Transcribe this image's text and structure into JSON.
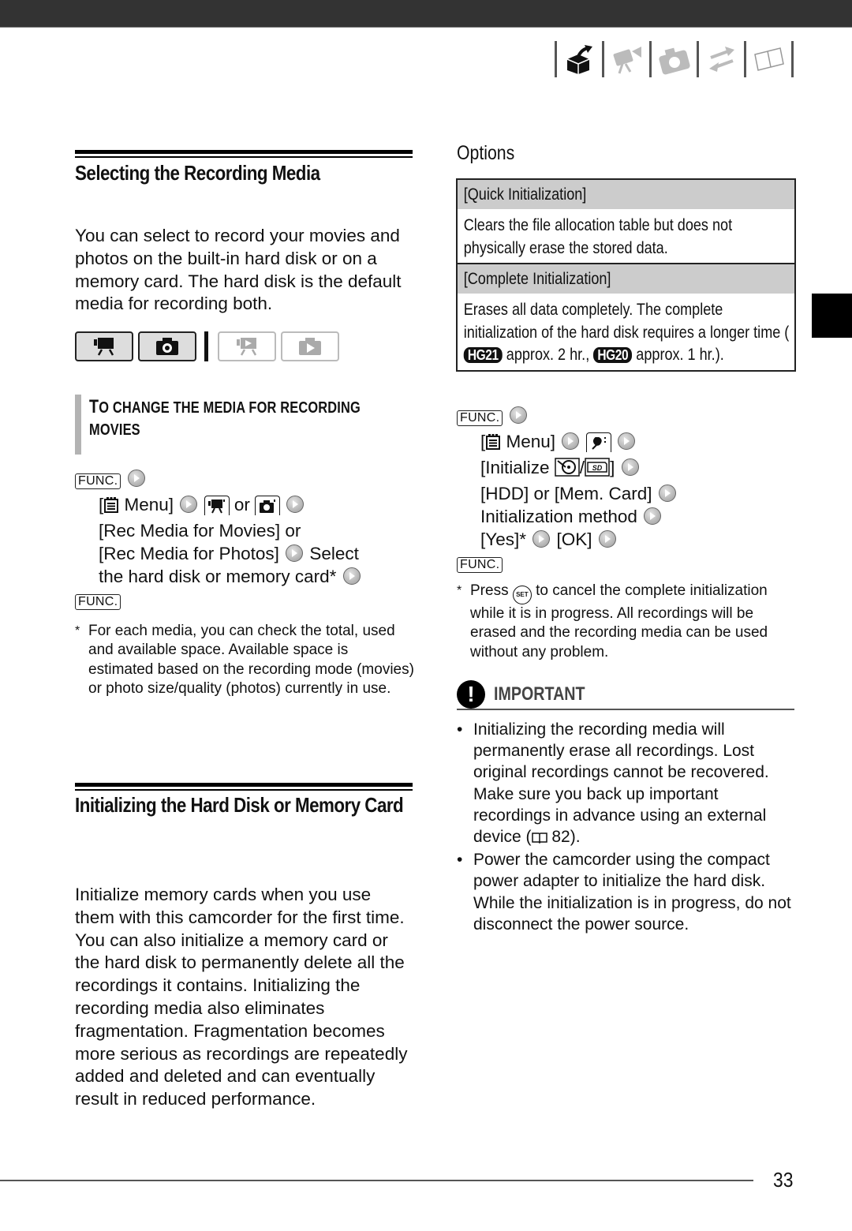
{
  "header": {
    "nav_icons": [
      "preparation-box-icon",
      "camcorder-tripod-icon",
      "camera-icon",
      "transfer-arrows-icon",
      "book-icon"
    ],
    "active_nav_icon": "preparation-box-icon"
  },
  "section1": {
    "title": "Selecting the Recording Media",
    "intro": "You can select to record your movies and photos on the built-in hard disk or on a memory card. The hard disk is the default media for recording both.",
    "mode_buttons": [
      {
        "name": "movie-record-mode",
        "icon": "camcorder-icon",
        "active": true
      },
      {
        "name": "photo-record-mode",
        "icon": "camera-icon",
        "active": true
      },
      {
        "name": "movie-playback-mode",
        "icon": "camcorder-play-icon",
        "active": false
      },
      {
        "name": "photo-playback-mode",
        "icon": "camera-play-icon",
        "active": false
      }
    ],
    "subheading_first": "T",
    "subheading_rest": "O CHANGE THE MEDIA FOR RECORDING",
    "subheading_line2": "MOVIES",
    "func_label": "FUNC.",
    "steps": {
      "menu_open": "[",
      "menu_label": " Menu]",
      "or1": " or ",
      "rec_movies": "[Rec Media for Movies] or",
      "rec_photos": "[Rec Media for Photos]",
      "select": " Select",
      "select2": "the hard disk or memory card*"
    },
    "footnote_star": "*",
    "footnote": "For each media, you can check the total, used and available space. Available space is estimated based on the recording mode (movies) or photo size/quality (photos) currently in use."
  },
  "section2": {
    "title": "Initializing the Hard Disk or Memory Card",
    "body": "Initialize memory cards when you use them with this camcorder for the first time. You can also initialize a memory card or the hard disk to permanently delete all the recordings it contains. Initializing the recording media also eliminates fragmentation. Fragmentation becomes more serious as recordings are repeatedly added and deleted and can eventually result in reduced performance."
  },
  "options": {
    "title": "Options",
    "rows": [
      {
        "header": "[Quick Initialization]",
        "desc": "Clears the file allocation table but does not physically erase the stored data."
      },
      {
        "header": "[Complete Initialization]",
        "desc_pre": "Erases all data completely. The complete initialization of the hard disk requires a longer time (",
        "badge1": "HG21",
        "mid": " approx. 2 hr., ",
        "badge2": "HG20",
        "desc_post": " approx. 1 hr.)."
      }
    ]
  },
  "init_steps": {
    "func_label": "FUNC.",
    "menu_open": "[",
    "menu_label": " Menu]",
    "initialize_open": "[Initialize ",
    "slash": "/",
    "close": "]",
    "hdd_or_card": "[HDD] or [Mem. Card]",
    "method": "Initialization method",
    "yes": "[Yes]*",
    "ok": "[OK]",
    "footnote_star": "*",
    "footnote_pre": "Press ",
    "set_label": "SET",
    "footnote_post": " to cancel the complete initialization while it is in progress. All recordings will be erased and the recording media can be used without any problem."
  },
  "important": {
    "label": "IMPORTANT",
    "bullets": [
      {
        "pre": "Initializing the recording media will permanently erase all recordings. Lost original recordings cannot be recovered. Make sure you back up important recordings in advance using an external device (",
        "page": " 82",
        "post": ")."
      },
      {
        "pre": "Power the camcorder using the compact power adapter to initialize the hard disk. While the initialization is in progress, do not disconnect the power source."
      }
    ]
  },
  "footer": {
    "page_number": "33"
  }
}
